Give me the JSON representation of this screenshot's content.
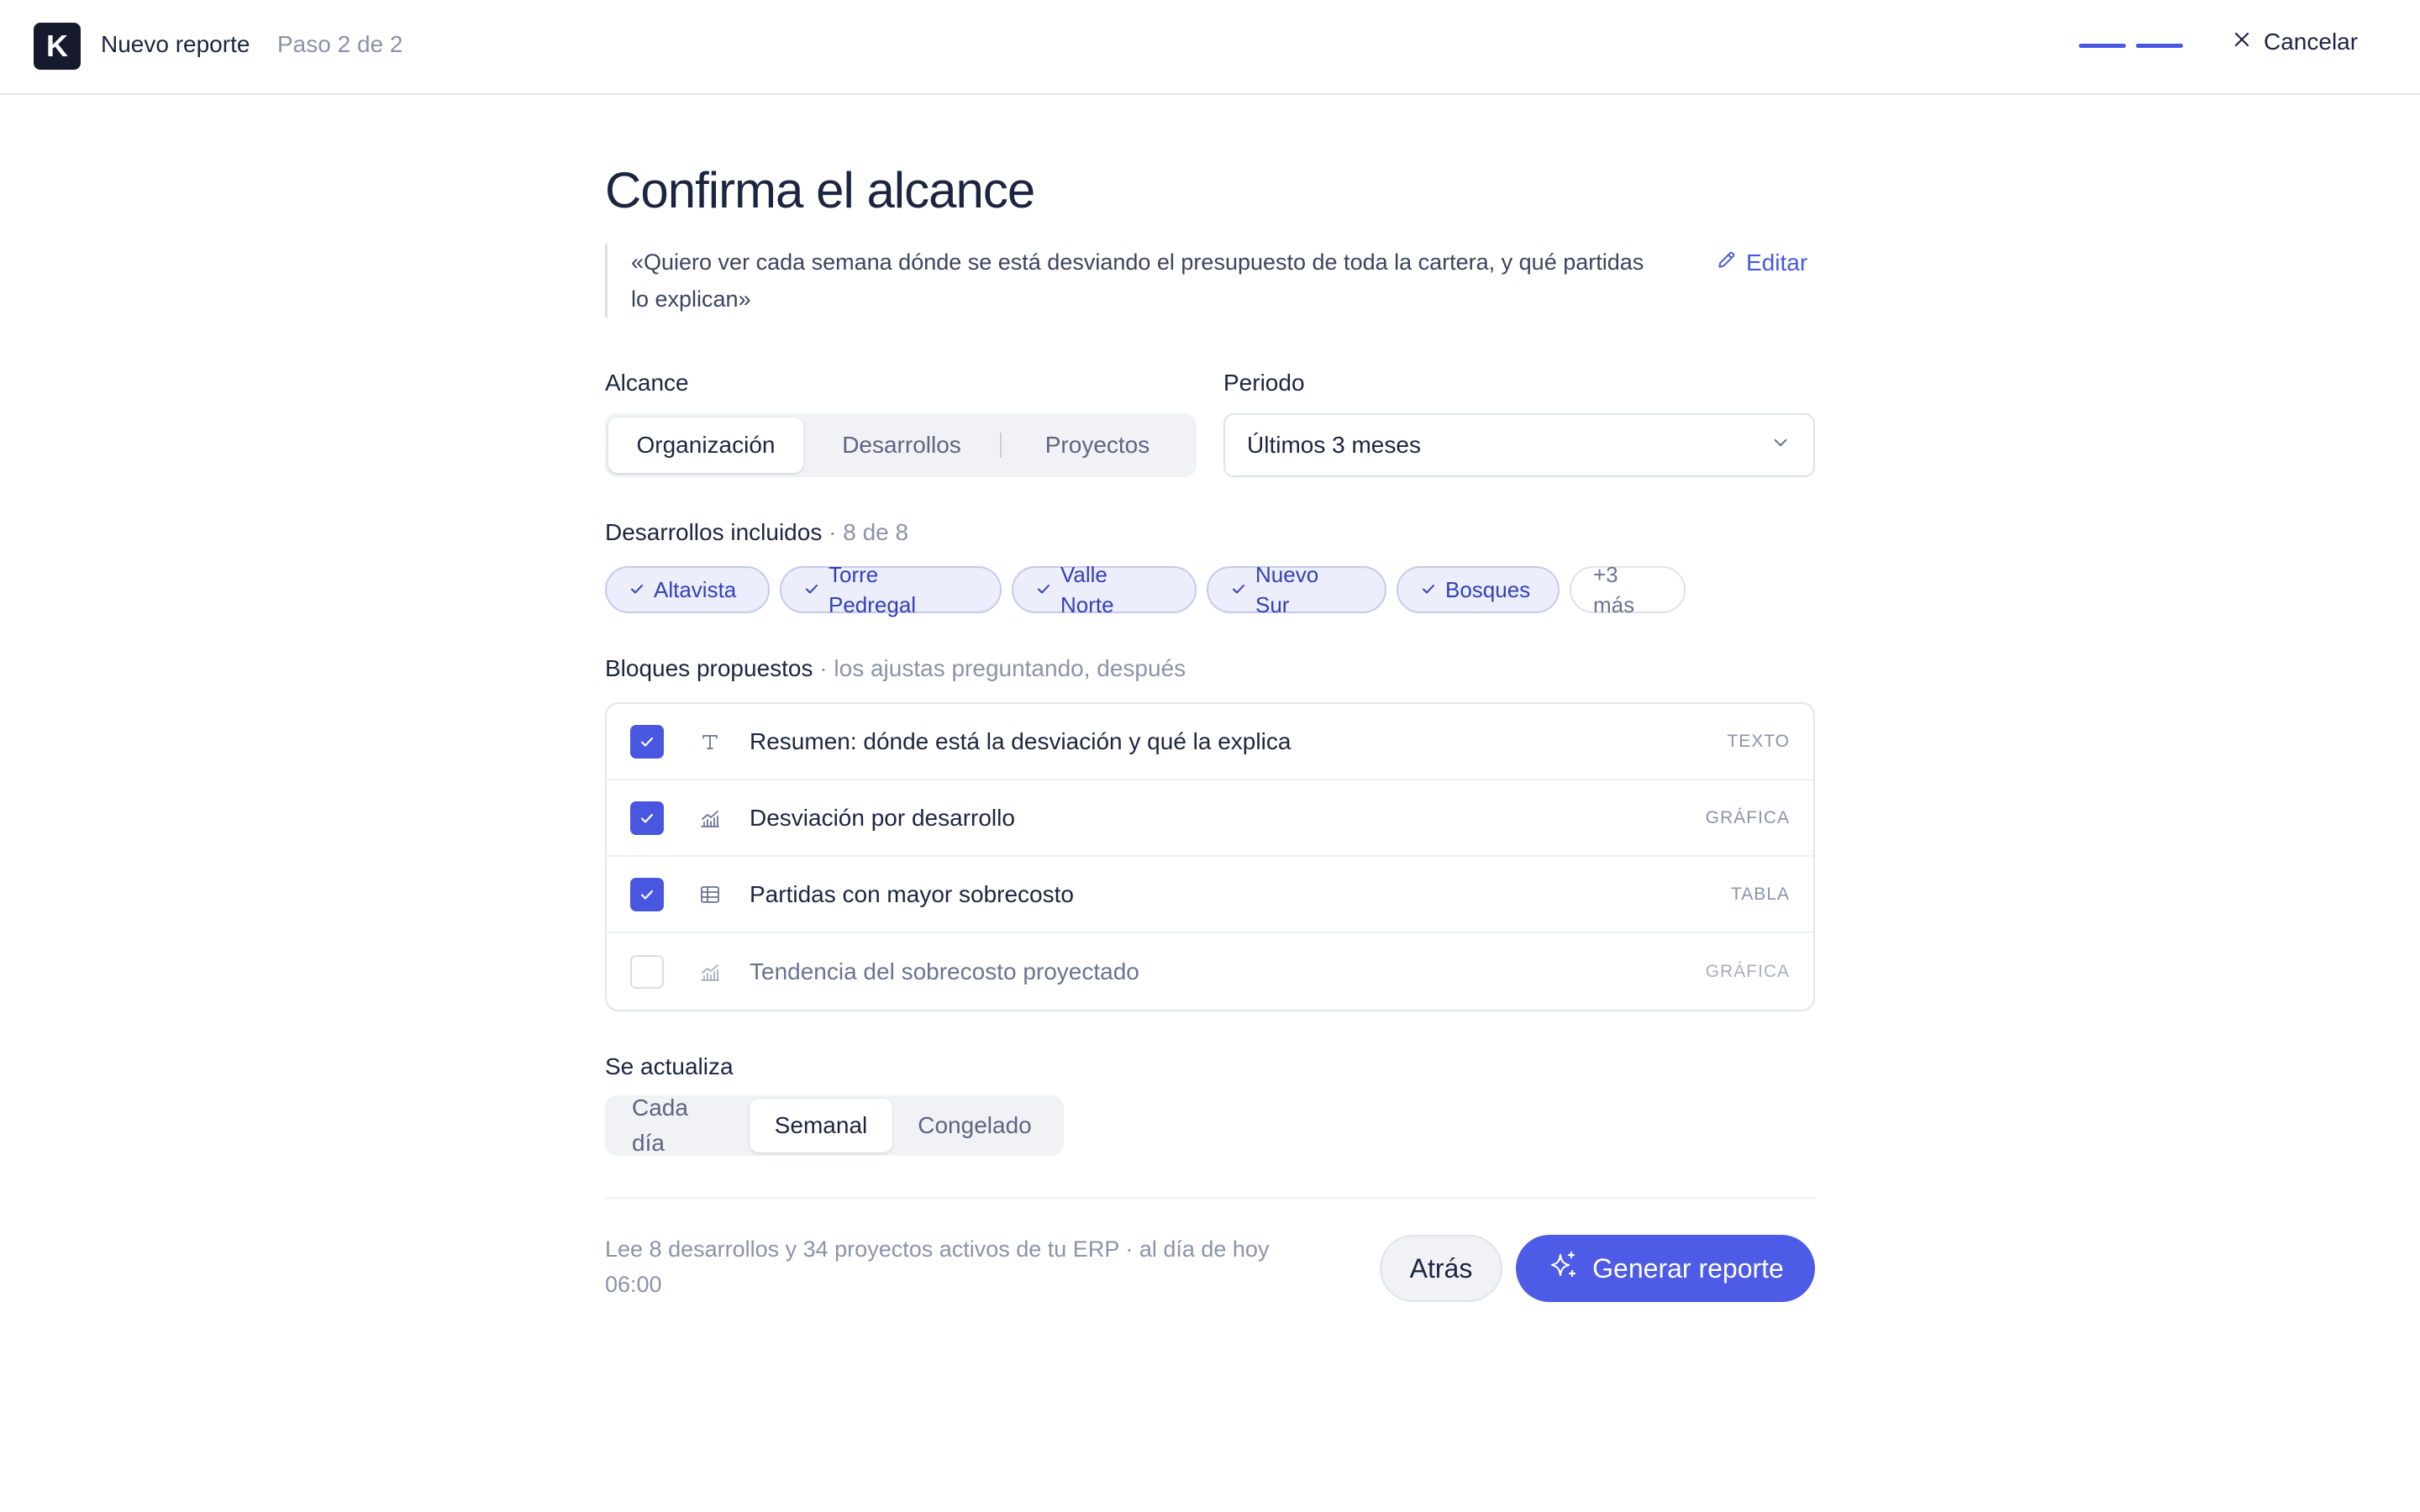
{
  "header": {
    "logo_letter": "K",
    "title": "Nuevo reporte",
    "step": "Paso 2 de 2",
    "progress": {
      "current_step": 2,
      "total_steps": 2
    },
    "cancel_label": "Cancelar"
  },
  "page": {
    "title": "Confirma el alcance",
    "quote": "«Quiero ver cada semana dónde se está desviando el presupuesto de toda la cartera, y qué partidas lo explican»",
    "edit_label": "Editar"
  },
  "scope": {
    "label": "Alcance",
    "options": [
      "Organización",
      "Desarrollos",
      "Proyectos"
    ],
    "selected": "Organización"
  },
  "period": {
    "label": "Periodo",
    "value": "Últimos 3 meses"
  },
  "developments": {
    "label": "Desarrollos incluidos",
    "count": "· 8 de 8",
    "chips": [
      "Altavista",
      "Torre Pedregal",
      "Valle Norte",
      "Nuevo Sur",
      "Bosques"
    ],
    "more": "+3 más"
  },
  "blocks": {
    "label": "Bloques propuestos",
    "hint": "· los ajustas preguntando, después",
    "items": [
      {
        "title": "Resumen: dónde está la desviación y qué la explica",
        "type": "TEXTO",
        "checked": true,
        "icon": "text-icon"
      },
      {
        "title": "Desviación por desarrollo",
        "type": "GRÁFICA",
        "checked": true,
        "icon": "chart-icon"
      },
      {
        "title": "Partidas con mayor sobrecosto",
        "type": "TABLA",
        "checked": true,
        "icon": "table-icon"
      },
      {
        "title": "Tendencia del sobrecosto proyectado",
        "type": "GRÁFICA",
        "checked": false,
        "icon": "chart-icon"
      }
    ]
  },
  "frequency": {
    "label": "Se actualiza",
    "options": [
      "Cada día",
      "Semanal",
      "Congelado"
    ],
    "selected": "Semanal"
  },
  "footer": {
    "note": "Lee 8 desarrollos y 34 proyectos activos de tu ERP · al día de hoy 06:00",
    "back_label": "Atrás",
    "generate_label": "Generar reporte"
  },
  "colors": {
    "accent": "#4957e0",
    "text": "#1c2540",
    "muted": "#8c93a8"
  }
}
